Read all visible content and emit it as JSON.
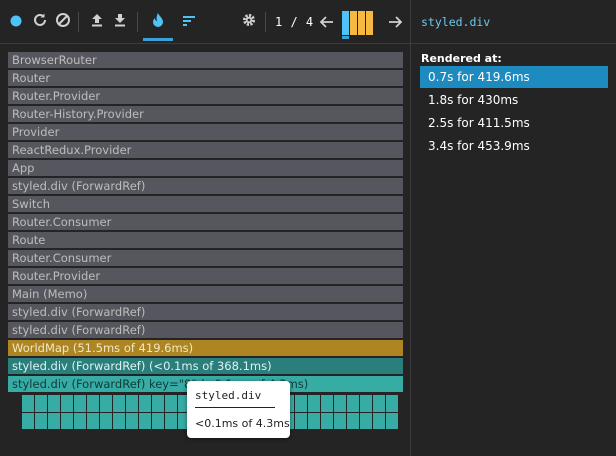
{
  "toolbar": {
    "icons": [
      "record-icon",
      "reload-icon",
      "clear-icon",
      "upload-icon",
      "download-icon",
      "flame-icon",
      "ranked-icon",
      "gear-icon",
      "prev-arrow-icon",
      "next-arrow-icon"
    ],
    "commit_counter": "1 / 4",
    "accent_color": "#3aa1d6",
    "commits": [
      {
        "relative_height": 1.0,
        "color": "#4fc3f7",
        "selected": true
      },
      {
        "relative_height": 1.0,
        "color": "#f5b942",
        "selected": false
      },
      {
        "relative_height": 1.0,
        "color": "#f5b942",
        "selected": false
      },
      {
        "relative_height": 1.0,
        "color": "#f5b942",
        "selected": false
      }
    ]
  },
  "flame": {
    "rows": [
      {
        "label": "BrowserRouter",
        "kind": "ancestor"
      },
      {
        "label": "Router",
        "kind": "ancestor"
      },
      {
        "label": "Router.Provider",
        "kind": "ancestor"
      },
      {
        "label": "Router-History.Provider",
        "kind": "ancestor"
      },
      {
        "label": "Provider",
        "kind": "ancestor"
      },
      {
        "label": "ReactRedux.Provider",
        "kind": "ancestor"
      },
      {
        "label": "App",
        "kind": "ancestor"
      },
      {
        "label": "styled.div (ForwardRef)",
        "kind": "ancestor"
      },
      {
        "label": "Switch",
        "kind": "ancestor"
      },
      {
        "label": "Router.Consumer",
        "kind": "ancestor"
      },
      {
        "label": "Route",
        "kind": "ancestor"
      },
      {
        "label": "Router.Consumer",
        "kind": "ancestor"
      },
      {
        "label": "Router.Provider",
        "kind": "ancestor"
      },
      {
        "label": "Main (Memo)",
        "kind": "ancestor"
      },
      {
        "label": "styled.div (ForwardRef)",
        "kind": "ancestor"
      },
      {
        "label": "styled.div (ForwardRef)",
        "kind": "ancestor"
      },
      {
        "label": "WorldMap (51.5ms of 419.6ms)",
        "kind": "yellow"
      },
      {
        "label": "styled.div (ForwardRef) (<0.1ms of 368.1ms)",
        "kind": "teal-dark"
      },
      {
        "label": "styled.div (ForwardRef) key=\"8\" (<0.1ms of 4.3ms)",
        "kind": "teal"
      }
    ],
    "colors": {
      "ancestor_bg": "#56565e",
      "ancestor_text": "#bdbdbd",
      "yellow_bg": "#ad8623",
      "teal_dark_bg": "#2a7f7c",
      "teal_bg": "#37aca5"
    }
  },
  "tooltip": {
    "title": "styled.div",
    "body": "<0.1ms of 4.3ms"
  },
  "side": {
    "title": "styled.div",
    "rendered_label": "Rendered at:",
    "renders": [
      {
        "label": "0.7s for 419.6ms",
        "selected": true
      },
      {
        "label": "1.8s for 430ms",
        "selected": false
      },
      {
        "label": "2.5s for 411.5ms",
        "selected": false
      },
      {
        "label": "3.4s for 453.9ms",
        "selected": false
      }
    ]
  }
}
